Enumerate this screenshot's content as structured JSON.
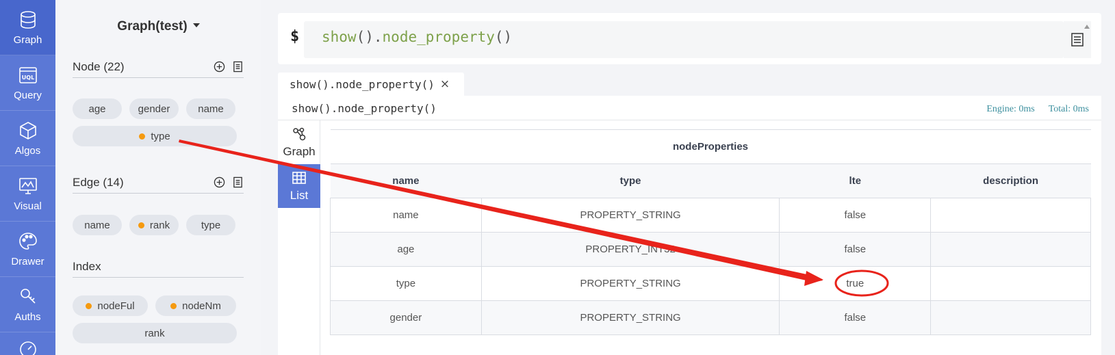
{
  "nav": [
    {
      "label": "Graph",
      "icon": "database-icon",
      "active": true
    },
    {
      "label": "Query",
      "icon": "uql-icon"
    },
    {
      "label": "Algos",
      "icon": "cube-icon"
    },
    {
      "label": "Visual",
      "icon": "monitor-chart-icon"
    },
    {
      "label": "Drawer",
      "icon": "palette-icon"
    },
    {
      "label": "Auths",
      "icon": "key-icon"
    }
  ],
  "sidebar": {
    "graph_title": "Graph(test)",
    "node": {
      "title": "Node (22)",
      "chips": [
        "age",
        "gender",
        "name",
        "type"
      ]
    },
    "edge": {
      "title": "Edge (14)",
      "chips": [
        "name",
        "rank",
        "type"
      ]
    },
    "index": {
      "title": "Index",
      "chips": [
        "nodeFul",
        "nodeNm",
        "rank"
      ]
    }
  },
  "command": {
    "prompt": "$",
    "fn1": "show",
    "paren1": "()",
    "dot": ".",
    "fn2": "node_property",
    "paren2": "()"
  },
  "tab": {
    "label": "show().node_property()",
    "close": "×"
  },
  "result": {
    "command_line": "show().node_property()",
    "engine": "Engine: 0ms",
    "total": "Total: 0ms",
    "view_tabs": [
      {
        "label": "Graph",
        "icon": "graph-nodes-icon"
      },
      {
        "label": "List",
        "icon": "table-icon",
        "active": true
      }
    ],
    "table": {
      "caption": "nodeProperties",
      "headers": [
        "name",
        "type",
        "lte",
        "description"
      ],
      "rows": [
        [
          "name",
          "PROPERTY_STRING",
          "false",
          ""
        ],
        [
          "age",
          "PROPERTY_INT32",
          "false",
          ""
        ],
        [
          "type",
          "PROPERTY_STRING",
          "true",
          ""
        ],
        [
          "gender",
          "PROPERTY_STRING",
          "false",
          ""
        ]
      ]
    }
  },
  "colors": {
    "nav": "#5b78d6",
    "accent_dot": "#f59a10",
    "annotation": "#e8231b",
    "timing": "#3c8f9e"
  }
}
